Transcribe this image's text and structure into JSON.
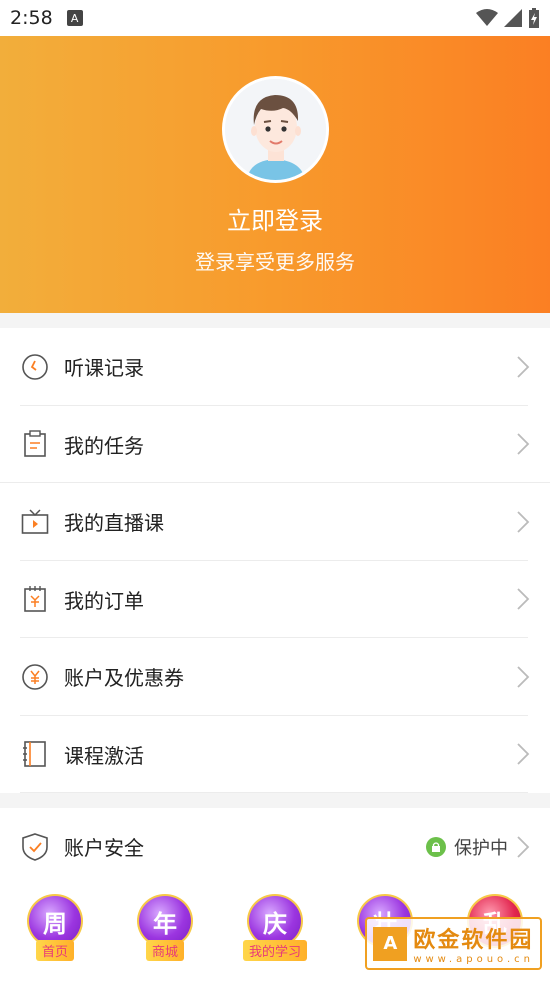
{
  "status": {
    "time": "2:58",
    "notif_glyph": "A"
  },
  "profile": {
    "login_title": "立即登录",
    "login_subtitle": "登录享受更多服务"
  },
  "menu_group1": [
    {
      "label": "听课记录",
      "icon": "clock-icon"
    },
    {
      "label": "我的任务",
      "icon": "clipboard-icon"
    },
    {
      "label": "我的直播课",
      "icon": "tv-icon"
    },
    {
      "label": "我的订单",
      "icon": "order-icon"
    },
    {
      "label": "账户及优惠券",
      "icon": "yen-coin-icon"
    },
    {
      "label": "课程激活",
      "icon": "notebook-icon"
    }
  ],
  "security": {
    "label": "账户安全",
    "status": "保护中"
  },
  "tabs": [
    {
      "glyph": "周",
      "label": "首页"
    },
    {
      "glyph": "年",
      "label": "商城"
    },
    {
      "glyph": "庆",
      "label": "我的学习"
    },
    {
      "glyph": "壮",
      "label": ""
    },
    {
      "glyph": "乱",
      "label": ""
    }
  ],
  "watermark": {
    "logo": "A",
    "text": "欧金软件园",
    "sub": "www.apouo.cn"
  },
  "colors": {
    "accent": "#fb7f23",
    "header_start": "#f2ae3b",
    "safe_green": "#6cc04a"
  }
}
